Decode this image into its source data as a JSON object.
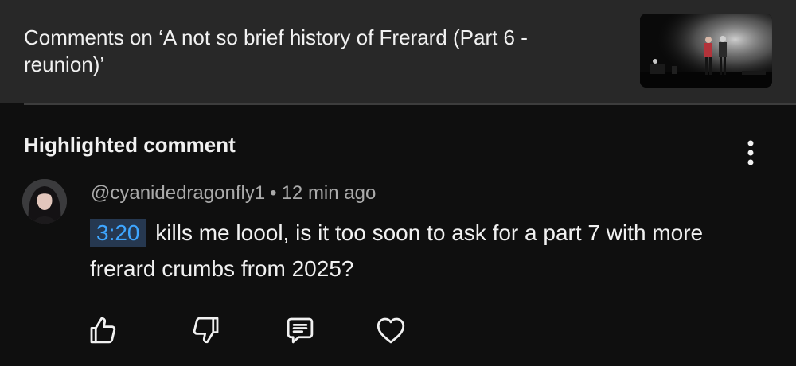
{
  "header": {
    "title": "Comments on ‘A not so brief history of Frerard (Part 6 - reunion)’"
  },
  "section": {
    "heading": "Highlighted comment"
  },
  "comment": {
    "author": "@cyanidedragonfly1",
    "separator": "•",
    "time": "12 min ago",
    "timestamp": "3:20",
    "text": "kills me loool, is it too soon to ask for a part 7 with more frerard crumbs from 2025?"
  },
  "icons": {
    "more": "more-vert-icon",
    "like": "thumb-up-icon",
    "dislike": "thumb-down-icon",
    "reply": "reply-comment-icon",
    "heart": "heart-icon"
  },
  "colors": {
    "background": "#0f0f0f",
    "header_background": "#282828",
    "timestamp_link": "#3ea6ff",
    "timestamp_background": "#263850",
    "secondary_text": "#aaaaaa"
  }
}
